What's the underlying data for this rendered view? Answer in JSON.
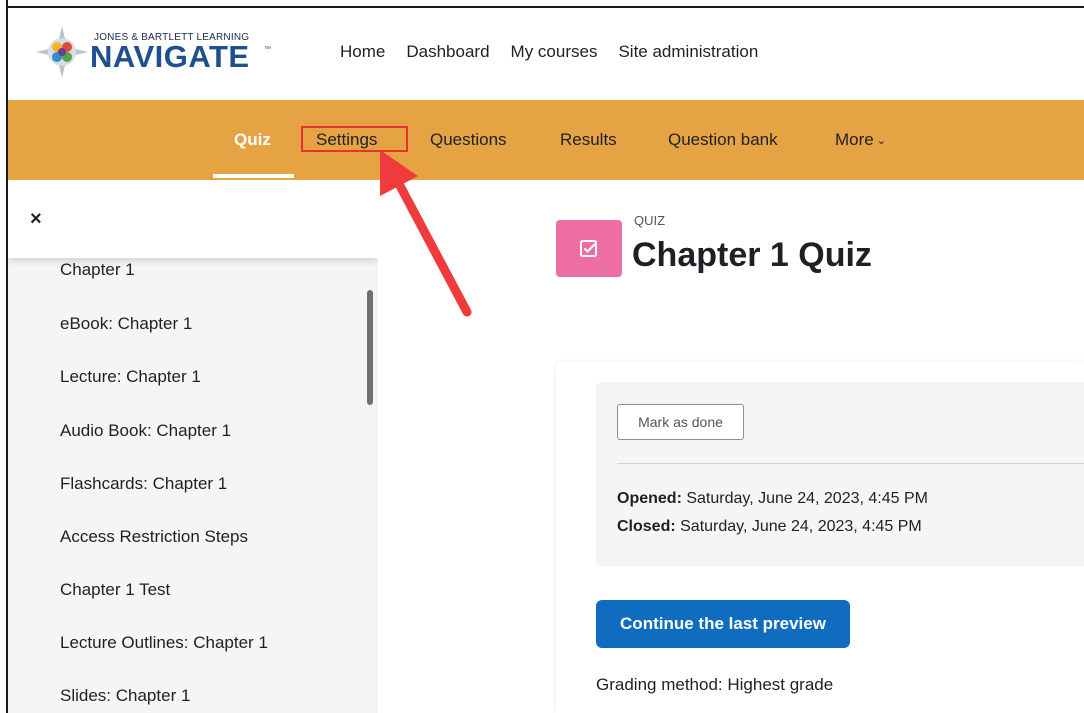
{
  "brand": {
    "small_text": "JONES & BARTLETT LEARNING",
    "name": "NAVIGATE",
    "tm": "™",
    "accent_color": "#e5a343"
  },
  "top_nav": [
    "Home",
    "Dashboard",
    "My courses",
    "Site administration"
  ],
  "secondary_nav": {
    "items": [
      "Quiz",
      "Settings",
      "Questions",
      "Results",
      "Question bank",
      "More"
    ],
    "active": "Quiz",
    "highlighted": "Settings"
  },
  "drawer": {
    "close_icon": "×",
    "items": [
      "Chapter 1",
      "eBook: Chapter 1",
      "Lecture: Chapter 1",
      "Audio Book: Chapter 1",
      "Flashcards: Chapter 1",
      "Access Restriction Steps",
      "Chapter 1 Test",
      "Lecture Outlines: Chapter 1",
      "Slides: Chapter 1"
    ]
  },
  "page": {
    "kind": "QUIZ",
    "title": "Chapter 1 Quiz",
    "icon": "checkbox-edit-icon",
    "icon_color": "#ec6ea3"
  },
  "activity": {
    "mark_done_label": "Mark as done",
    "opened_label": "Opened:",
    "opened_value": " Saturday, June 24, 2023, 4:45 PM",
    "closed_label": "Closed:",
    "closed_value": " Saturday, June 24, 2023, 4:45 PM"
  },
  "actions": {
    "continue_label": "Continue the last preview",
    "grading_method": "Grading method: Highest grade"
  }
}
